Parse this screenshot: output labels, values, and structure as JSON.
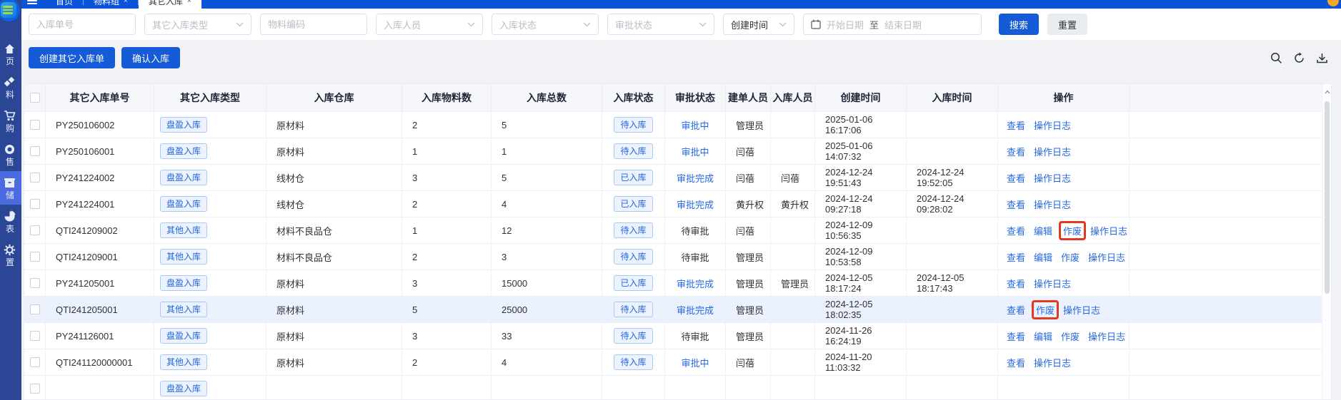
{
  "topbar": {
    "tabs": [
      {
        "label": "首页",
        "closable": false,
        "active": false
      },
      {
        "label": "物料组",
        "closable": true,
        "active": false
      },
      {
        "label": "其它入库",
        "closable": true,
        "active": true
      }
    ]
  },
  "sidebar": {
    "items": [
      {
        "label": "页",
        "icon": "home-icon"
      },
      {
        "label": "料",
        "icon": "materials-icon"
      },
      {
        "label": "购",
        "icon": "purchase-cart-icon"
      },
      {
        "label": "售",
        "icon": "sales-icon"
      },
      {
        "label": "储",
        "icon": "warehouse-icon",
        "active": true
      },
      {
        "label": "表",
        "icon": "report-pie-icon"
      },
      {
        "label": "置",
        "icon": "settings-gear-icon"
      }
    ]
  },
  "filters": {
    "order_no_placeholder": "入库单号",
    "type_placeholder": "其它入库类型",
    "material_code_placeholder": "物料编码",
    "handler_placeholder": "入库人员",
    "status_placeholder": "入库状态",
    "approval_placeholder": "审批状态",
    "time_field_value": "创建时间",
    "date_start_placeholder": "开始日期",
    "date_separator": "至",
    "date_end_placeholder": "结束日期",
    "search_label": "搜索",
    "reset_label": "重置"
  },
  "actions": {
    "create_label": "创建其它入库单",
    "confirm_label": "确认入库"
  },
  "toolbar_icons": [
    "search-icon",
    "refresh-icon",
    "download-icon"
  ],
  "colors": {
    "topbar_blue": "#0b53d8",
    "sidebar_blue": "#2c4696",
    "sidebar_active": "#4b6ce0",
    "primary_button": "#155ad6",
    "link_blue": "#2468e5",
    "badge_text": "#2166dd",
    "badge_bg": "#ecf3fe",
    "annotation_red": "#e23a1f",
    "row_highlight": "#ecf2fd"
  },
  "table": {
    "headers": [
      "",
      "其它入库单号",
      "其它入库类型",
      "入库仓库",
      "入库物料数",
      "入库总数",
      "入库状态",
      "审批状态",
      "建单人员",
      "入库人员",
      "创建时间",
      "入库时间",
      "操作",
      ""
    ],
    "rows": [
      {
        "order": "PY250106002",
        "type": "盘盈入库",
        "warehouse": "原材料",
        "materials": "2",
        "total": "5",
        "status": "待入库",
        "approval": "审批中",
        "approval_is_link": true,
        "creator": "管理员",
        "handler": "",
        "created": "2025-01-06 16:17:06",
        "stored": "",
        "ops": [
          {
            "label": "查看"
          },
          {
            "label": "操作日志"
          }
        ]
      },
      {
        "order": "PY250106001",
        "type": "盘盈入库",
        "warehouse": "原材料",
        "materials": "1",
        "total": "1",
        "status": "待入库",
        "approval": "审批中",
        "approval_is_link": true,
        "creator": "闫蓓",
        "handler": "",
        "created": "2025-01-06 14:07:32",
        "stored": "",
        "ops": [
          {
            "label": "查看"
          },
          {
            "label": "操作日志"
          }
        ]
      },
      {
        "order": "PY241224002",
        "type": "盘盈入库",
        "warehouse": "线材仓",
        "materials": "3",
        "total": "5",
        "status": "已入库",
        "approval": "审批完成",
        "approval_is_link": true,
        "creator": "闫蓓",
        "handler": "闫蓓",
        "created": "2024-12-24 19:51:43",
        "stored": "2024-12-24 19:52:05",
        "ops": [
          {
            "label": "查看"
          },
          {
            "label": "操作日志"
          }
        ]
      },
      {
        "order": "PY241224001",
        "type": "盘盈入库",
        "warehouse": "线材仓",
        "materials": "2",
        "total": "4",
        "status": "已入库",
        "approval": "审批完成",
        "approval_is_link": true,
        "creator": "黄升权",
        "handler": "黄升权",
        "created": "2024-12-24 09:27:18",
        "stored": "2024-12-24 09:28:02",
        "ops": [
          {
            "label": "查看"
          },
          {
            "label": "操作日志"
          }
        ]
      },
      {
        "order": "QTI241209002",
        "type": "其他入库",
        "warehouse": "材料不良品仓",
        "materials": "1",
        "total": "12",
        "status": "待入库",
        "approval": "待审批",
        "approval_is_link": false,
        "creator": "闫蓓",
        "handler": "",
        "created": "2024-12-09 10:56:35",
        "stored": "",
        "ops": [
          {
            "label": "查看"
          },
          {
            "label": "编辑"
          },
          {
            "label": "作废",
            "boxed": true
          },
          {
            "label": "操作日志"
          }
        ]
      },
      {
        "order": "QTI241209001",
        "type": "其他入库",
        "warehouse": "材料不良品仓",
        "materials": "2",
        "total": "3",
        "status": "待入库",
        "approval": "待审批",
        "approval_is_link": false,
        "creator": "管理员",
        "handler": "",
        "created": "2024-12-09 10:53:58",
        "stored": "",
        "ops": [
          {
            "label": "查看"
          },
          {
            "label": "编辑"
          },
          {
            "label": "作废"
          },
          {
            "label": "操作日志"
          }
        ]
      },
      {
        "order": "PY241205001",
        "type": "盘盈入库",
        "warehouse": "原材料",
        "materials": "3",
        "total": "15000",
        "status": "已入库",
        "approval": "审批完成",
        "approval_is_link": true,
        "creator": "管理员",
        "handler": "管理员",
        "created": "2024-12-05 18:17:24",
        "stored": "2024-12-05 18:17:43",
        "ops": [
          {
            "label": "查看"
          },
          {
            "label": "操作日志"
          }
        ]
      },
      {
        "order": "QTI241205001",
        "type": "其他入库",
        "warehouse": "原材料",
        "materials": "5",
        "total": "25000",
        "status": "待入库",
        "approval": "审批完成",
        "approval_is_link": true,
        "creator": "管理员",
        "handler": "",
        "created": "2024-12-05 18:02:35",
        "stored": "",
        "highlighted": true,
        "ops": [
          {
            "label": "查看"
          },
          {
            "label": "作废",
            "boxed": true
          },
          {
            "label": "操作日志"
          }
        ]
      },
      {
        "order": "PY241126001",
        "type": "盘盈入库",
        "warehouse": "原材料",
        "materials": "3",
        "total": "33",
        "status": "待入库",
        "approval": "待审批",
        "approval_is_link": false,
        "creator": "管理员",
        "handler": "",
        "created": "2024-11-26 16:24:19",
        "stored": "",
        "ops": [
          {
            "label": "查看"
          },
          {
            "label": "编辑"
          },
          {
            "label": "作废"
          },
          {
            "label": "操作日志"
          }
        ]
      },
      {
        "order": "QTI241120000001",
        "type": "其他入库",
        "warehouse": "原材料",
        "materials": "2",
        "total": "4",
        "status": "待入库",
        "approval": "审批中",
        "approval_is_link": true,
        "creator": "闫蓓",
        "handler": "",
        "created": "2024-11-20 11:03:32",
        "stored": "",
        "ops": [
          {
            "label": "查看"
          },
          {
            "label": "操作日志"
          }
        ]
      },
      {
        "order": "",
        "type": "盘盈入库",
        "warehouse": "",
        "materials": "",
        "total": "",
        "status": "",
        "approval": "",
        "approval_is_link": false,
        "creator": "",
        "handler": "",
        "created": "",
        "stored": "",
        "partial": true,
        "ops": []
      }
    ]
  }
}
